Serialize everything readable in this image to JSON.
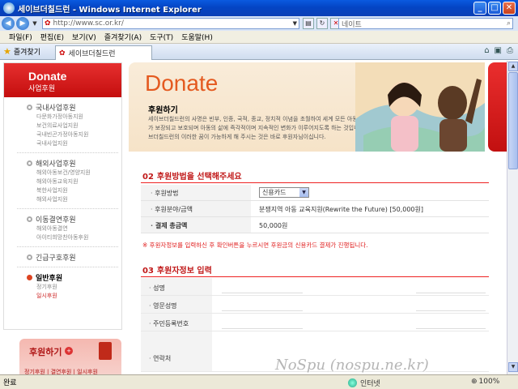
{
  "window": {
    "title": "세이브더칠드런 - Windows Internet Explorer",
    "min": "_",
    "max": "□",
    "close": "✕"
  },
  "address": {
    "url": "http://www.sc.or.kr/",
    "search_placeholder": "네이트"
  },
  "menu": [
    "파일(F)",
    "편집(E)",
    "보기(V)",
    "즐겨찾기(A)",
    "도구(T)",
    "도움말(H)"
  ],
  "tabs": {
    "favorites_label": "즐겨찾기",
    "active_tab": "세이브더칠드런"
  },
  "sidebar": {
    "heading": "Donate",
    "subheading": "사업후원",
    "groups": [
      {
        "title": "국내사업후원",
        "items": [
          "다문화가정아동지원",
          "보건의료사업지원",
          "국내빈곤가정아동지원",
          "국내사업지원"
        ]
      },
      {
        "title": "해외사업후원",
        "items": [
          "해외아동보건/영양지원",
          "해외아동교육지원",
          "북한사업지원",
          "해외사업지원"
        ]
      },
      {
        "title": "이동결연후원",
        "items": [
          "해외아동결연",
          "아이티희망찬아동후원"
        ]
      },
      {
        "title": "긴급구호후원",
        "items": []
      },
      {
        "title": "일반후원",
        "items": [
          "정기후원",
          "일시후원"
        ]
      }
    ],
    "donate_box": {
      "title": "후원하기",
      "links": "정기후원 | 결연후원 | 일시후원"
    }
  },
  "banner": {
    "big_word": "Donate",
    "title": "후원하기",
    "desc": "세이브더칠드런의 사명은 빈부, 인종, 국적, 종교, 정치적 이념을 초월하여 세계 모든 아동들의 권리가 보장되고 보호되며 아동의 삶에 즉각적이며 지속적인 변화가 이루어지도록 하는 것입니다. 세이브더칠드런의 이러한 꿈이 가능하게 해 주시는 것은 바로 후원자님이십니다."
  },
  "section2": {
    "num": "02",
    "title": "후원방법을 선택해주세요",
    "rows": [
      {
        "label": "후원방법",
        "value": "신용카드"
      },
      {
        "label": "후원분야/금액",
        "value": "분쟁지역 아동 교육지원(Rewrite the Future) [50,000원]"
      },
      {
        "label": "결제 총금액",
        "value": "50,000원"
      }
    ],
    "notice": "※ 후원자정보를 입력하신 후 확인버튼을 누르시면 후원금의 신용카드 결제가 진행됩니다."
  },
  "section3": {
    "num": "03",
    "title": "후원자정보 입력",
    "rows": [
      "성명",
      "영문성명",
      "주민등록번호",
      "연락처"
    ]
  },
  "status": {
    "text": "완료",
    "zone": "인터넷",
    "zoom": "100%"
  },
  "watermark": "NoSpu (nospu.ne.kr)"
}
